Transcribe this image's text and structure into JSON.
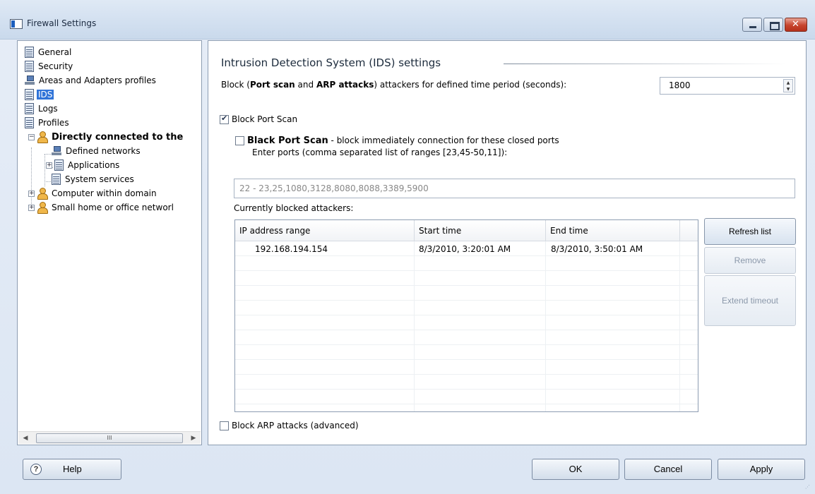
{
  "window": {
    "title": "Firewall Settings"
  },
  "tree": {
    "items": [
      {
        "label": "General",
        "icon": "document-icon"
      },
      {
        "label": "Security",
        "icon": "document-icon"
      },
      {
        "label": "Areas and Adapters profiles",
        "icon": "network-icon"
      },
      {
        "label": "IDS",
        "icon": "document-icon",
        "selected": true
      },
      {
        "label": "Logs",
        "icon": "document-icon"
      },
      {
        "label": "Profiles",
        "icon": "document-icon"
      },
      {
        "label": "Directly connected to the",
        "icon": "user-icon",
        "expander": "−"
      },
      {
        "label": "Defined networks",
        "icon": "network-icon"
      },
      {
        "label": "Applications",
        "icon": "document-icon",
        "expander": "+"
      },
      {
        "label": "System services",
        "icon": "document-icon"
      },
      {
        "label": "Computer within domain",
        "icon": "user-icon",
        "expander": "+"
      },
      {
        "label": "Small home or office networl",
        "icon": "user-icon",
        "expander": "+"
      }
    ],
    "scroll_thumb": "III"
  },
  "ids": {
    "title": "Intrusion Detection System (IDS) settings",
    "block_prefix": "Block (",
    "block_port_scan_bold": "Port scan",
    "block_and": " and ",
    "block_arp_bold": "ARP attacks",
    "block_suffix": ") attackers for defined time period (seconds):",
    "time_value": "1800",
    "block_port_scan_label": "Block Port Scan",
    "block_port_scan_checked": true,
    "black_port_scan_bold": "Black Port Scan",
    "black_port_scan_rest": " - block immediately connection for these closed ports",
    "black_port_scan_checked": false,
    "enter_ports_label": "Enter ports (comma separated list of ranges [23,45-50,11]):",
    "ports_value": "22 - 23,25,1080,3128,8080,8088,3389,5900",
    "blocked_label": "Currently blocked attackers:",
    "columns": [
      "IP address range",
      "Start time",
      "End time"
    ],
    "rows": [
      {
        "ip": "192.168.194.154",
        "start": "8/3/2010, 3:20:01 AM",
        "end": "8/3/2010, 3:50:01 AM"
      }
    ],
    "refresh_label": "Refresh list",
    "remove_label": "Remove",
    "extend_label": "Extend timeout",
    "arp_label": "Block ARP attacks (advanced)",
    "arp_checked": false
  },
  "footer": {
    "help_label": "Help",
    "ok_label": "OK",
    "cancel_label": "Cancel",
    "apply_label": "Apply"
  }
}
